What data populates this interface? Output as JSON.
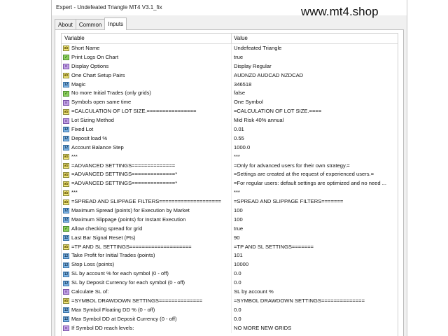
{
  "window": {
    "title": "Expert - Undefeated Triangle MT4 V3.1_fix"
  },
  "watermark": "www.mt4.shop",
  "tabs": [
    "About",
    "Common",
    "Inputs"
  ],
  "active_tab": "Inputs",
  "table": {
    "headers": {
      "variable": "Variable",
      "value": "Value"
    },
    "rows": [
      {
        "variable": "Short Name",
        "value": "Undefeated Triangle",
        "type": "ab"
      },
      {
        "variable": "Print Logs On Chart",
        "value": "true",
        "type": "bool"
      },
      {
        "variable": "Display Options",
        "value": "Display Regular",
        "type": "enum"
      },
      {
        "variable": "One Chart Setup Pairs",
        "value": "AUDNZD AUDCAD NZDCAD",
        "type": "ab"
      },
      {
        "variable": "Magic",
        "value": "346518",
        "type": "num"
      },
      {
        "variable": "No more Initial Trades (only grids)",
        "value": "false",
        "type": "bool"
      },
      {
        "variable": "Symbols open same time",
        "value": "One Symbol",
        "type": "enum"
      },
      {
        "variable": "=CALCULATION OF LOT SIZE.================",
        "value": "=CALCULATION OF LOT SIZE.====",
        "type": "ab"
      },
      {
        "variable": "Lot Sizing Method",
        "value": "Mid Risk 40% annual",
        "type": "enum"
      },
      {
        "variable": "Fixed Lot",
        "value": "0.01",
        "type": "num"
      },
      {
        "variable": "Deposit load %",
        "value": "0.55",
        "type": "num"
      },
      {
        "variable": "Account Balance Step",
        "value": "1000.0",
        "type": "num"
      },
      {
        "variable": "***",
        "value": "***",
        "type": "ab"
      },
      {
        "variable": "=ADVANCED SETTINGS==============",
        "value": "=Only for advanced users for their own strategy.=",
        "type": "ab"
      },
      {
        "variable": "=ADVANCED SETTINGS==============*",
        "value": "=Settings are created at the request of experienced users.=",
        "type": "ab"
      },
      {
        "variable": "=ADVANCED SETTINGS==============*",
        "value": "=For regular users: default settings are optimized and no need ...",
        "type": "ab"
      },
      {
        "variable": "***",
        "value": "***",
        "type": "ab"
      },
      {
        "variable": "=SPREAD AND SLIPPAGE FILTERS====================",
        "value": "=SPREAD AND SLIPPAGE FILTERS=======",
        "type": "ab"
      },
      {
        "variable": "Maximum Spread (points) for Execution by Market",
        "value": "100",
        "type": "num"
      },
      {
        "variable": "Maximum Slippage (points) for Instant Execution",
        "value": "100",
        "type": "num"
      },
      {
        "variable": "Allow checking spread for grid",
        "value": "true",
        "type": "bool"
      },
      {
        "variable": "Last Bar Signal Reset (Pts)",
        "value": "90",
        "type": "num"
      },
      {
        "variable": "=TP AND SL SETTINGS====================",
        "value": "=TP AND SL SETTINGS=======",
        "type": "ab"
      },
      {
        "variable": "Take Profit for Initial Trades (points)",
        "value": "101",
        "type": "num"
      },
      {
        "variable": "Stop Loss (points)",
        "value": "10000",
        "type": "num"
      },
      {
        "variable": "SL by account % for each symbol (0 - off)",
        "value": "0.0",
        "type": "num"
      },
      {
        "variable": "SL by Deposit Currency for each symbol (0 - off)",
        "value": "0.0",
        "type": "num"
      },
      {
        "variable": "Calculate SL of:",
        "value": "SL by account %",
        "type": "enum"
      },
      {
        "variable": "=SYMBOL DRAWDOWN SETTINGS==============",
        "value": "=SYMBOL DRAWDOWN SETTINGS==============",
        "type": "ab"
      },
      {
        "variable": "Max Symbol Floating DD % (0 - off)",
        "value": "0.0",
        "type": "num"
      },
      {
        "variable": "Max Symbol DD at Deposit Currency (0 - off)",
        "value": "0.0",
        "type": "num"
      },
      {
        "variable": "If Symbol DD reach levels:",
        "value": "NO MORE NEW GRIDS",
        "type": "enum"
      }
    ]
  }
}
